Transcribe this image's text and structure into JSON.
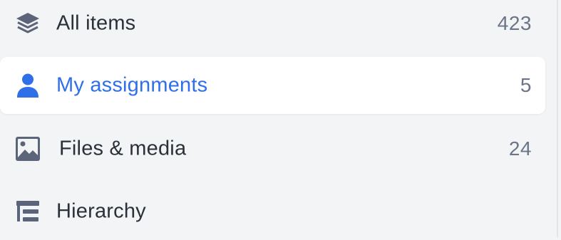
{
  "nav": {
    "items": [
      {
        "label": "All items",
        "count": "423",
        "icon": "layers-icon",
        "active": false
      },
      {
        "label": "My assignments",
        "count": "5",
        "icon": "user-icon",
        "active": true
      },
      {
        "label": "Files & media",
        "count": "24",
        "icon": "image-icon",
        "active": false
      },
      {
        "label": "Hierarchy",
        "count": "",
        "icon": "hierarchy-icon",
        "active": false
      }
    ]
  },
  "colors": {
    "accent": "#2f6fe8",
    "text": "#2b3139",
    "muted": "#6b7588",
    "icon": "#5b6478",
    "background": "#f3f4f6",
    "active_background": "#ffffff"
  }
}
